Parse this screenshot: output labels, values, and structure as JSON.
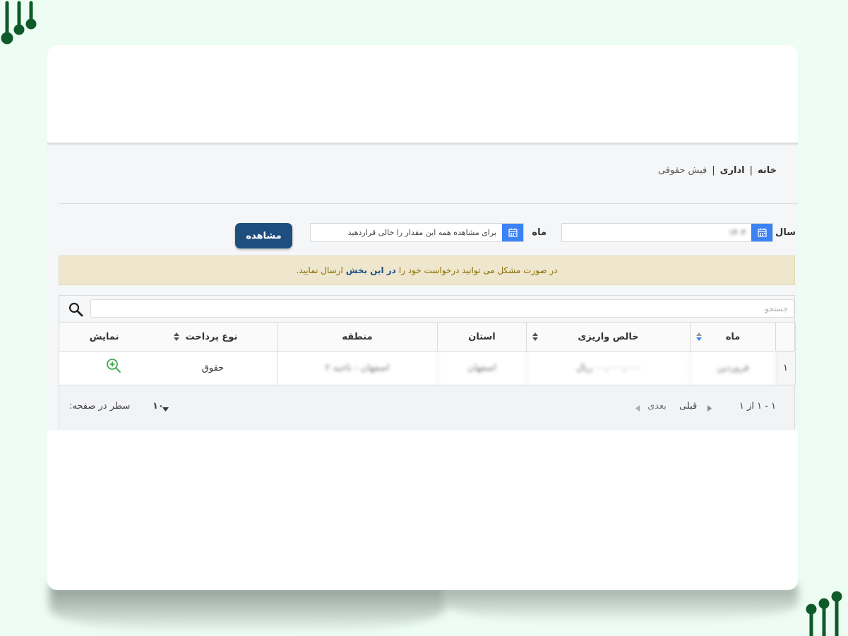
{
  "breadcrumb": {
    "home": "خانه",
    "admin": "اداری",
    "current": "فیش حقوقی"
  },
  "filters": {
    "year_label": "سال",
    "year_value": "۱۴۰۳",
    "month_label": "ماه",
    "month_placeholder": "برای مشاهده همه این مقدار را خالی قراردهید",
    "view_button": "مشاهده"
  },
  "alert": {
    "part1": "در صورت مشکل می توانید درخواست خود را",
    "link": "در این بخش",
    "part2": "ارسال نمایید."
  },
  "table": {
    "search_placeholder": "جستجو",
    "headers": {
      "month": "ماه",
      "net_paid": "خالص واریزی",
      "province": "استان",
      "region": "منطقه",
      "payment_type": "نوع پرداخت",
      "show": "نمایش"
    },
    "rows": [
      {
        "index": "۱",
        "month": "فروردین",
        "net_paid": "۰۰,۰۰۰,۰۰۰ ریال",
        "province": "اصفهان",
        "region": "اصفهان - ناحیه ۲",
        "payment_type": "حقوق"
      }
    ],
    "pagination": {
      "range": "۱ - ۱ از ۱",
      "prev": "قبلی",
      "next": "بعدی",
      "page_size": "۱۰",
      "rows_per_page": "سطر در صفحه:"
    }
  },
  "colors": {
    "background": "#edfdf3",
    "primary_button": "#1e4e7e",
    "calendar_icon_bg": "#3b82f6",
    "alert_bg": "#eee7cd",
    "logo_green": "#0f5a2a"
  }
}
